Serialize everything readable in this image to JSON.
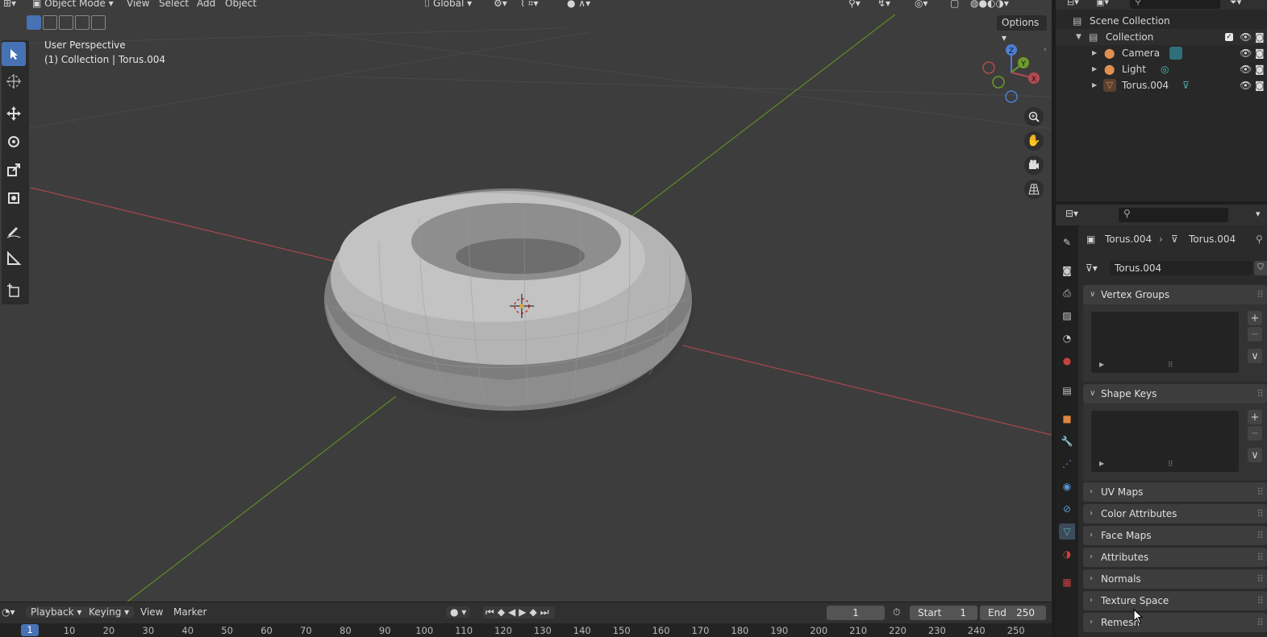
{
  "viewport_header": {
    "mode_label": "Object Mode",
    "menus": [
      "View",
      "Select",
      "Add",
      "Object"
    ],
    "orientation_label": "Global",
    "options_label": "Options"
  },
  "viewport": {
    "view_name": "User Perspective",
    "collection_info": "(1) Collection | Torus.004",
    "gizmo_axes": [
      "Z",
      "Y",
      "X"
    ]
  },
  "timeline": {
    "menus": [
      "Playback",
      "Keying",
      "View",
      "Marker"
    ],
    "current_frame": "1",
    "start_label": "Start",
    "start_value": "1",
    "end_label": "End",
    "end_value": "250",
    "ruler_current": "1",
    "ruler_ticks": [
      "10",
      "20",
      "30",
      "40",
      "50",
      "60",
      "70",
      "80",
      "90",
      "100",
      "110",
      "120",
      "130",
      "140",
      "150",
      "160",
      "170",
      "180",
      "190",
      "200",
      "210",
      "220",
      "230",
      "240",
      "250"
    ]
  },
  "outliner": {
    "scene_collection": "Scene Collection",
    "collection": "Collection",
    "items": [
      "Camera",
      "Light",
      "Torus.004"
    ]
  },
  "properties": {
    "breadcrumb_object": "Torus.004",
    "breadcrumb_data": "Torus.004",
    "mesh_name": "Torus.004",
    "panels_open": [
      "Vertex Groups",
      "Shape Keys"
    ],
    "panels_closed": [
      "UV Maps",
      "Color Attributes",
      "Face Maps",
      "Attributes",
      "Normals",
      "Texture Space",
      "Remesh"
    ]
  },
  "colors": {
    "accent": "#4772b3",
    "x_axis": "#b34a52",
    "y_axis": "#6d9a2e",
    "z_axis": "#4a7fd4"
  }
}
